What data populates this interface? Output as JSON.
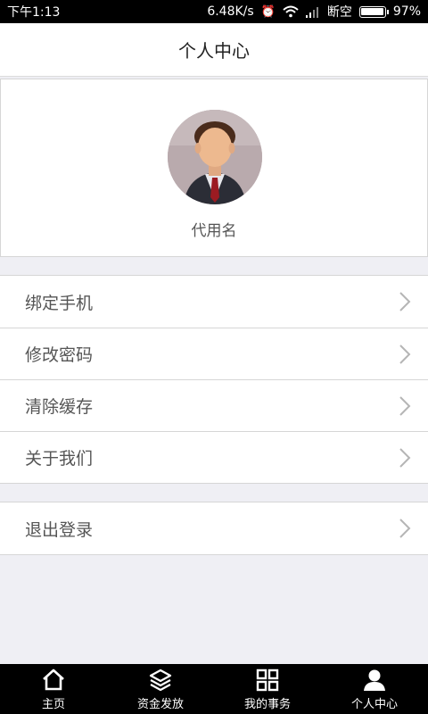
{
  "status_bar": {
    "time": "下午1:13",
    "speed": "6.48K/s",
    "network": "断空",
    "battery": "97%",
    "battery_level": 0.97
  },
  "header": {
    "title": "个人中心"
  },
  "profile": {
    "username": "代用名"
  },
  "menu": {
    "items": [
      {
        "label": "绑定手机"
      },
      {
        "label": "修改密码"
      },
      {
        "label": "清除缓存"
      },
      {
        "label": "关于我们"
      }
    ],
    "logout": "退出登录"
  },
  "bottom_nav": {
    "items": [
      {
        "label": "主页",
        "icon": "home-icon"
      },
      {
        "label": "资金发放",
        "icon": "layers-icon"
      },
      {
        "label": "我的事务",
        "icon": "grid-icon"
      },
      {
        "label": "个人中心",
        "icon": "user-icon"
      }
    ],
    "active_index": 3
  },
  "colors": {
    "background": "#efeff4",
    "nav_bg": "#000000",
    "text_primary": "#222222",
    "text_secondary": "#555555",
    "divider": "#d6d6d6"
  }
}
